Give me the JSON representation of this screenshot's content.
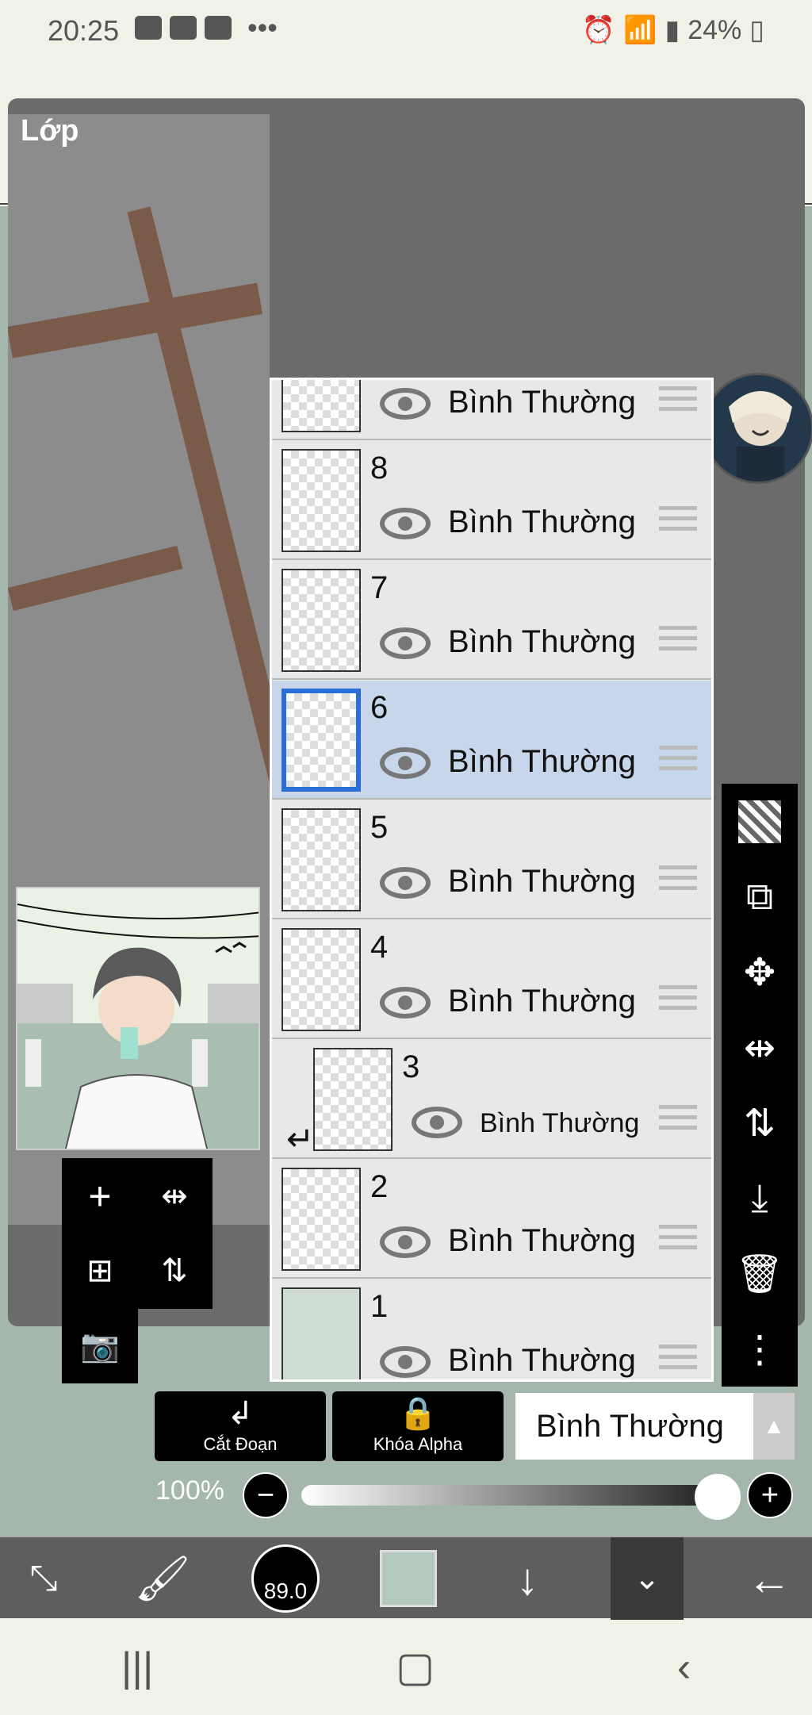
{
  "status_bar": {
    "time": "20:25",
    "left_icons": [
      "image-icon",
      "youtube-icon",
      "youtube-icon",
      "more-dots"
    ],
    "right_icons": [
      "alarm-icon",
      "wifi-icon",
      "signal-icon",
      "signal-icon",
      "battery-icon"
    ],
    "battery": "24%"
  },
  "panel": {
    "title": "Lớp"
  },
  "layers": [
    {
      "number": "",
      "blend": "Bình Thường",
      "selected": false
    },
    {
      "number": "8",
      "blend": "Bình Thường",
      "selected": false
    },
    {
      "number": "7",
      "blend": "Bình Thường",
      "selected": false
    },
    {
      "number": "6",
      "blend": "Bình Thường",
      "selected": true
    },
    {
      "number": "5",
      "blend": "Bình Thường",
      "selected": false
    },
    {
      "number": "4",
      "blend": "Bình Thường",
      "selected": false
    },
    {
      "number": "3",
      "blend": "Bình Thường",
      "selected": false,
      "clipped": true
    },
    {
      "number": "2",
      "blend": "Bình Thường",
      "selected": false
    },
    {
      "number": "1",
      "blend": "Bình Thường",
      "selected": false
    }
  ],
  "layer_actions": {
    "clip_label": "Cắt Đoạn",
    "alpha_lock_label": "Khóa Alpha",
    "blend_mode": "Bình Thường"
  },
  "opacity": {
    "label": "100%",
    "value": 100
  },
  "toolbar": {
    "brush_size": "89.0",
    "color": "#b4c8bd"
  },
  "colors": {
    "selected_border": "#2a6fd6",
    "selected_row": "#c8d6ec"
  }
}
